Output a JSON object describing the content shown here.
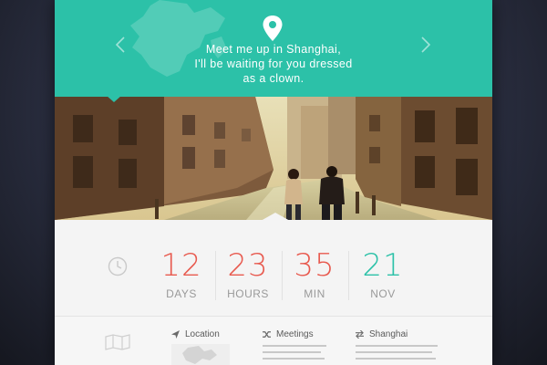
{
  "header": {
    "quote_lines": [
      "Meet me up in Shanghai,",
      "I'll be waiting for you dressed",
      "as a clown."
    ],
    "accent_color": "#2cc1a8",
    "icons": {
      "pin": "location-pin-icon",
      "prev": "chevron-left-icon",
      "next": "chevron-right-icon"
    }
  },
  "countdown": {
    "items": [
      {
        "value": "12",
        "label": "DAYS",
        "color": "#e85a4f"
      },
      {
        "value": "23",
        "label": "HOURS",
        "color": "#e85a4f"
      },
      {
        "value": "35",
        "label": "MIN",
        "color": "#e85a4f"
      },
      {
        "value": "21",
        "label": "NOV",
        "color": "#2cc1a8"
      }
    ],
    "icon": "clock-icon"
  },
  "info": {
    "icon": "map-icon",
    "columns": [
      {
        "title": "Location",
        "icon": "location-arrow-icon"
      },
      {
        "title": "Meetings",
        "icon": "shuffle-icon"
      },
      {
        "title": "Shanghai",
        "icon": "exchange-icon"
      }
    ]
  }
}
